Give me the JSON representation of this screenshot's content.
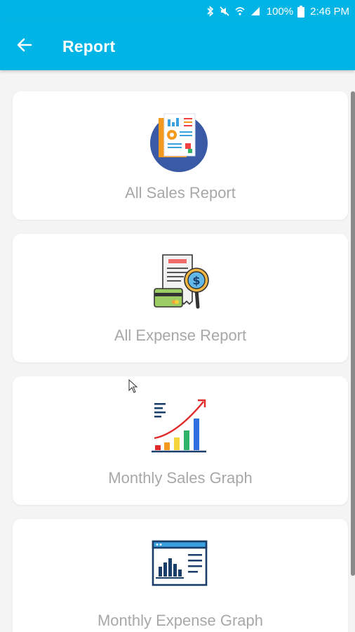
{
  "status_bar": {
    "battery": "100%",
    "time": "2:46 PM",
    "icons": [
      "bluetooth-icon",
      "mute-icon",
      "wifi-icon",
      "signal-icon",
      "battery-icon"
    ]
  },
  "app_bar": {
    "back_icon": "arrow-left-icon",
    "title": "Report"
  },
  "cards": [
    {
      "label": "All Sales Report",
      "icon": "sales-report-icon"
    },
    {
      "label": "All Expense Report",
      "icon": "expense-report-icon"
    },
    {
      "label": "Monthly Sales Graph",
      "icon": "sales-graph-icon"
    },
    {
      "label": "Monthly Expense Graph",
      "icon": "expense-graph-icon"
    }
  ],
  "colors": {
    "primary": "#00b5e6",
    "background": "#f4f4f4",
    "card": "#ffffff",
    "label": "#a8a8a8"
  }
}
